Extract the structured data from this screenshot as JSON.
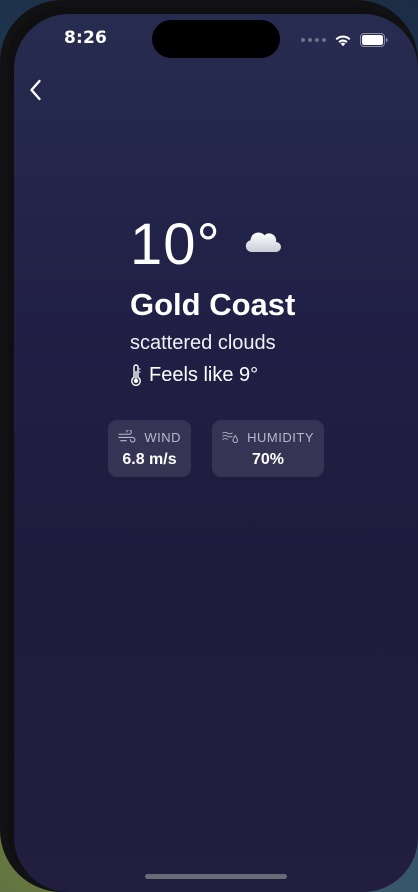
{
  "status_bar": {
    "time": "8:26",
    "icons": [
      "cellular-signal-icon",
      "wifi-icon",
      "battery-icon"
    ]
  },
  "navigation": {
    "back_icon": "chevron-left-icon"
  },
  "weather": {
    "temperature": "10°",
    "condition_icon": "cloud-icon",
    "city": "Gold Coast",
    "description": "scattered clouds",
    "feels_like": "Feels like 9°"
  },
  "stats": {
    "wind": {
      "icon": "wind-icon",
      "label": "WIND",
      "value": "6.8 m/s"
    },
    "humidity": {
      "icon": "humidity-icon",
      "label": "HUMIDITY",
      "value": "70%"
    }
  },
  "colors": {
    "background_top": "#262c50",
    "background_bottom": "#1e1b3c",
    "card_background": "rgba(255,255,255,0.10)",
    "text_primary": "#ffffff",
    "text_secondary": "#b7b8cb"
  }
}
